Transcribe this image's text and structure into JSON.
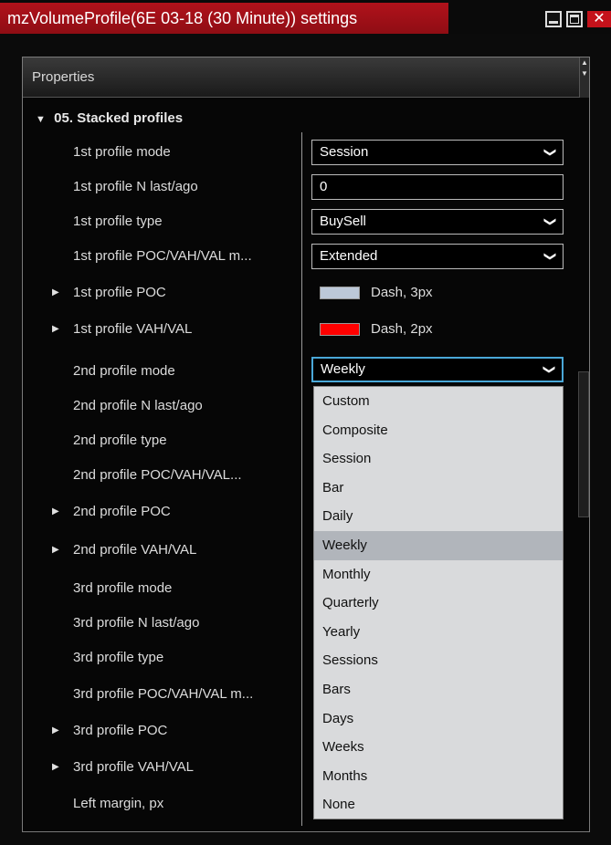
{
  "window": {
    "title": "mzVolumeProfile(6E 03-18 (30 Minute)) settings",
    "close_glyph": "✕"
  },
  "panel": {
    "header": "Properties"
  },
  "group": {
    "label": "05. Stacked profiles"
  },
  "rows": [
    {
      "label": "1st profile mode",
      "value": "Session"
    },
    {
      "label": "1st profile N last/ago",
      "value": "0"
    },
    {
      "label": "1st profile type",
      "value": "BuySell"
    },
    {
      "label": "1st profile POC/VAH/VAL m...",
      "value": "Extended"
    },
    {
      "label": "1st profile POC",
      "value": "Dash, 3px",
      "swatch": "#bcc8d8"
    },
    {
      "label": "1st profile VAH/VAL",
      "value": "Dash, 2px",
      "swatch": "#ff0000"
    },
    {
      "label": "2nd profile mode",
      "value": "Weekly"
    },
    {
      "label": "2nd profile N last/ago"
    },
    {
      "label": "2nd profile type"
    },
    {
      "label": "2nd profile POC/VAH/VAL..."
    },
    {
      "label": "2nd profile POC"
    },
    {
      "label": "2nd profile VAH/VAL"
    },
    {
      "label": "3rd profile mode"
    },
    {
      "label": "3rd profile N last/ago"
    },
    {
      "label": "3rd profile type"
    },
    {
      "label": "3rd profile POC/VAH/VAL m..."
    },
    {
      "label": "3rd profile POC"
    },
    {
      "label": "3rd profile VAH/VAL"
    },
    {
      "label": "Left margin, px"
    }
  ],
  "dropdown": {
    "selected": "Weekly",
    "options": [
      "Custom",
      "Composite",
      "Session",
      "Bar",
      "Daily",
      "Weekly",
      "Monthly",
      "Quarterly",
      "Yearly",
      "Sessions",
      "Bars",
      "Days",
      "Weeks",
      "Months",
      "None"
    ]
  }
}
